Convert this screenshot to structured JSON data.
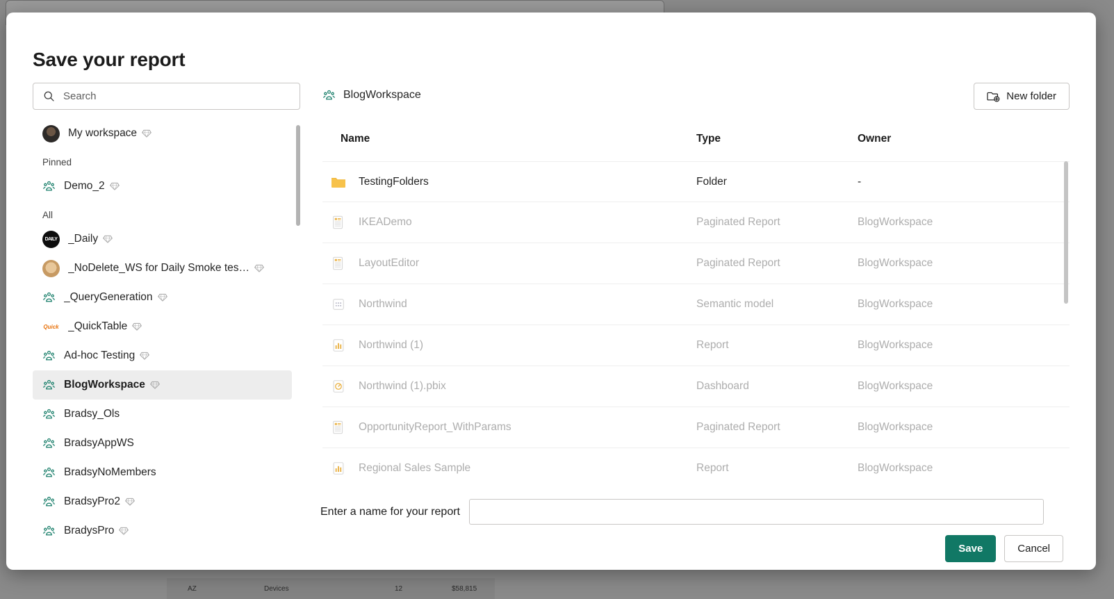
{
  "background": {
    "table_row": [
      "AZ",
      "Devices",
      "12",
      "$58,815"
    ]
  },
  "dialog": {
    "title": "Save your report"
  },
  "search": {
    "placeholder": "Search",
    "value": "",
    "icon": "search-icon"
  },
  "sidebar": {
    "items": [
      {
        "label": "My workspace",
        "icon": "avatar-photo",
        "gem": true,
        "kind": "avatar",
        "selected": false
      },
      {
        "label": "Pinned",
        "kind": "section"
      },
      {
        "label": "Demo_2",
        "icon": "workspace-group-icon",
        "gem": true,
        "kind": "workspace",
        "selected": false
      },
      {
        "label": "All",
        "kind": "section"
      },
      {
        "label": "_Daily",
        "icon": "avatar-dark",
        "gem": true,
        "kind": "avatar",
        "selected": false,
        "avatar_text": "DAILY"
      },
      {
        "label": "_NoDelete_WS for Daily Smoke tes…",
        "icon": "avatar-dog",
        "gem": true,
        "kind": "avatar",
        "selected": false
      },
      {
        "label": "_QueryGeneration",
        "icon": "workspace-group-icon",
        "gem": true,
        "kind": "workspace",
        "selected": false
      },
      {
        "label": "_QuickTable",
        "icon": "avatar-quick",
        "gem": true,
        "kind": "avatar",
        "selected": false,
        "avatar_text": "Quick"
      },
      {
        "label": "Ad-hoc Testing",
        "icon": "workspace-group-icon",
        "gem": true,
        "kind": "workspace",
        "selected": false
      },
      {
        "label": "BlogWorkspace",
        "icon": "workspace-group-icon",
        "gem": true,
        "kind": "workspace",
        "selected": true
      },
      {
        "label": "Bradsy_Ols",
        "icon": "workspace-group-icon",
        "gem": false,
        "kind": "workspace",
        "selected": false
      },
      {
        "label": "BradsyAppWS",
        "icon": "workspace-group-icon",
        "gem": false,
        "kind": "workspace",
        "selected": false
      },
      {
        "label": "BradsyNoMembers",
        "icon": "workspace-group-icon",
        "gem": false,
        "kind": "workspace",
        "selected": false
      },
      {
        "label": "BradsyPro2",
        "icon": "workspace-group-icon",
        "gem": true,
        "kind": "workspace",
        "selected": false
      },
      {
        "label": "BradysPro",
        "icon": "workspace-group-icon",
        "gem": true,
        "kind": "workspace",
        "selected": false
      }
    ]
  },
  "content": {
    "breadcrumb": "BlogWorkspace",
    "breadcrumb_icon": "workspace-group-icon",
    "new_folder_label": "New folder",
    "new_folder_icon": "new-folder-icon",
    "columns": [
      "Name",
      "Type",
      "Owner"
    ],
    "rows": [
      {
        "name": "TestingFolders",
        "type": "Folder",
        "owner": "-",
        "icon": "folder-icon",
        "enabled": true
      },
      {
        "name": "IKEADemo",
        "type": "Paginated Report",
        "owner": "BlogWorkspace",
        "icon": "paginated-report-icon",
        "enabled": false
      },
      {
        "name": "LayoutEditor",
        "type": "Paginated Report",
        "owner": "BlogWorkspace",
        "icon": "paginated-report-icon",
        "enabled": false
      },
      {
        "name": "Northwind",
        "type": "Semantic model",
        "owner": "BlogWorkspace",
        "icon": "semantic-model-icon",
        "enabled": false
      },
      {
        "name": "Northwind (1)",
        "type": "Report",
        "owner": "BlogWorkspace",
        "icon": "report-icon",
        "enabled": false
      },
      {
        "name": "Northwind (1).pbix",
        "type": "Dashboard",
        "owner": "BlogWorkspace",
        "icon": "dashboard-icon",
        "enabled": false
      },
      {
        "name": "OpportunityReport_WithParams",
        "type": "Paginated Report",
        "owner": "BlogWorkspace",
        "icon": "paginated-report-icon",
        "enabled": false
      },
      {
        "name": "Regional Sales Sample",
        "type": "Report",
        "owner": "BlogWorkspace",
        "icon": "report-icon",
        "enabled": false
      }
    ]
  },
  "footer": {
    "name_label": "Enter a name for your report",
    "name_value": "",
    "name_placeholder": "",
    "save_label": "Save",
    "cancel_label": "Cancel"
  },
  "colors": {
    "accent": "#117865",
    "workspace_icon": "#1a7f6b",
    "folder": "#f3c14a",
    "selected_row_bg": "#ededed",
    "disabled_text": "#adadad"
  }
}
